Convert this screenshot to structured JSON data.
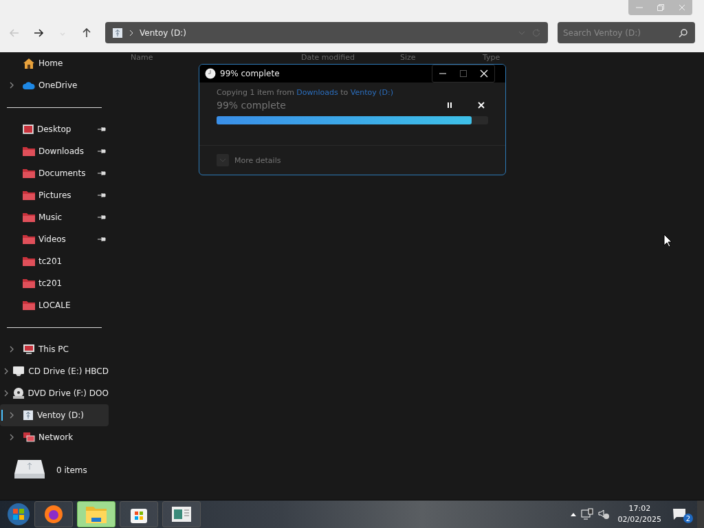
{
  "nav": {
    "back_disabled": true,
    "forward_disabled": false,
    "recent_disabled": true,
    "address": "Ventoy (D:)",
    "search": {
      "placeholder": "Search Ventoy (D:)"
    }
  },
  "columns": [
    "Name",
    "Date modified",
    "Size",
    "Type"
  ],
  "sidebar": {
    "groups": [
      [
        {
          "label": "Home",
          "kind": "home",
          "expandable": false,
          "pinned": false,
          "selected": false
        },
        {
          "label": "OneDrive",
          "kind": "cloud",
          "expandable": true,
          "pinned": false,
          "selected": false
        }
      ],
      [
        {
          "label": "Desktop",
          "kind": "desktop",
          "expandable": false,
          "pinned": true,
          "selected": false
        },
        {
          "label": "Downloads",
          "kind": "folder",
          "expandable": false,
          "pinned": true,
          "selected": false
        },
        {
          "label": "Documents",
          "kind": "folder",
          "expandable": false,
          "pinned": true,
          "selected": false
        },
        {
          "label": "Pictures",
          "kind": "folder",
          "expandable": false,
          "pinned": true,
          "selected": false
        },
        {
          "label": "Music",
          "kind": "folder",
          "expandable": false,
          "pinned": true,
          "selected": false
        },
        {
          "label": "Videos",
          "kind": "folder",
          "expandable": false,
          "pinned": true,
          "selected": false
        },
        {
          "label": "tc201",
          "kind": "folder",
          "expandable": false,
          "pinned": false,
          "selected": false
        },
        {
          "label": "tc201",
          "kind": "folder",
          "expandable": false,
          "pinned": false,
          "selected": false
        },
        {
          "label": "LOCALE",
          "kind": "folder",
          "expandable": false,
          "pinned": false,
          "selected": false
        }
      ],
      [
        {
          "label": "This PC",
          "kind": "pc",
          "expandable": true,
          "pinned": false,
          "selected": false
        },
        {
          "label": "CD Drive (E:) HBCD",
          "kind": "cd",
          "expandable": true,
          "pinned": false,
          "selected": false
        },
        {
          "label": "DVD Drive (F:) DOO",
          "kind": "dvd",
          "expandable": true,
          "pinned": false,
          "selected": false
        },
        {
          "label": "Ventoy (D:)",
          "kind": "usb",
          "expandable": true,
          "pinned": false,
          "selected": true
        },
        {
          "label": "Network",
          "kind": "network",
          "expandable": true,
          "pinned": false,
          "selected": false
        }
      ]
    ]
  },
  "status": {
    "count": "0 items"
  },
  "dialog": {
    "title": "99% complete",
    "message_start": "Copying 1 item from",
    "source": "Downloads",
    "message_mid": "to",
    "destination": "Ventoy (D:)",
    "progress_text": "99% complete",
    "level": 0.94,
    "details": "More details"
  },
  "taskbar": {
    "apps": [
      {
        "kind": "firefox",
        "selected": false
      },
      {
        "kind": "explorer",
        "selected": true
      },
      {
        "kind": "store",
        "selected": false
      },
      {
        "kind": "document",
        "selected": false
      }
    ],
    "time": "17:02",
    "date": "02/02/2025",
    "notifications": "2"
  }
}
